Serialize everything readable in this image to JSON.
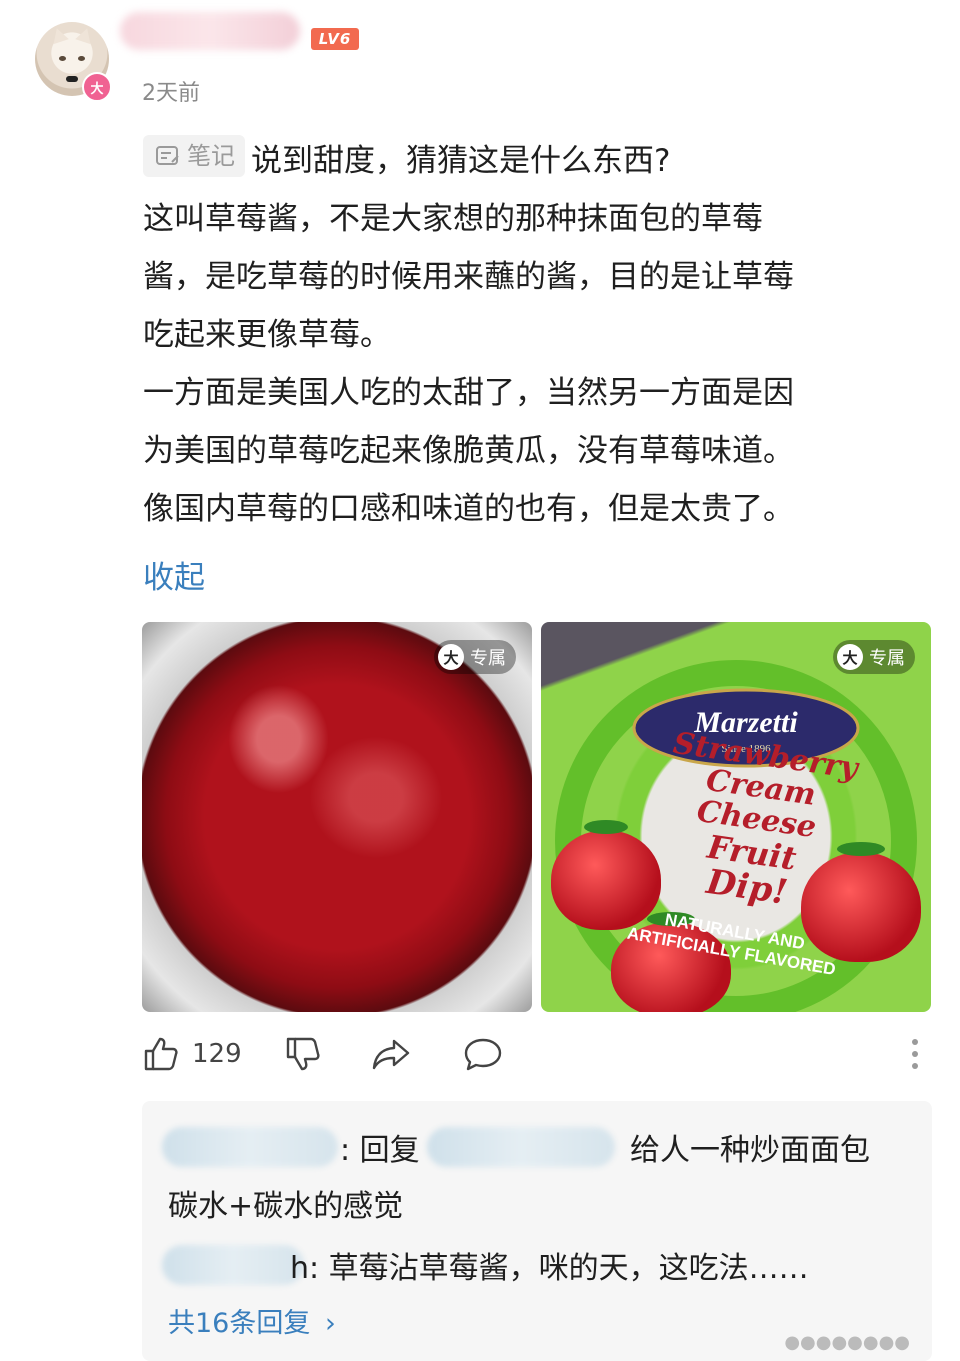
{
  "comment": {
    "level_badge": "LV6",
    "avatar_badge": "大",
    "timestamp": "2天前",
    "note_tag": "笔记",
    "lines": [
      "说到甜度，猜猜这是什么东西?",
      "这叫草莓酱，不是大家想的那种抹面包的草莓",
      "酱，是吃草莓的时候用来蘸的酱，目的是让草莓",
      "吃起来更像草莓。",
      "一方面是美国人吃的太甜了，当然另一方面是因",
      "为美国的草莓吃起来像脆黄瓜，没有草莓味道。",
      "像国内草莓的口感和味道的也有，但是太贵了。"
    ],
    "collapse_label": "收起"
  },
  "images": {
    "exclusive_icon": "大",
    "exclusive_label": "专属",
    "product": {
      "brand": "Marzetti",
      "since": "Since 1896",
      "name_lines": [
        "Strawberry",
        "Cream Cheese",
        "Fruit",
        "Dip!"
      ],
      "flavor_lines": [
        "NATURALLY AND",
        "ARTIFICIALLY FLAVORED"
      ]
    }
  },
  "actions": {
    "like_count": "129"
  },
  "replies": {
    "items": [
      {
        "text_a": ": 回复",
        "text_b": "给人一种炒面面包",
        "text_c": "碳水+碳水的感觉"
      },
      {
        "text_a": "h: 草莓沾草莓酱，咪的天，这吃法……"
      }
    ],
    "total_label": "共16条回复",
    "chevron": "›"
  },
  "watermark": "●●●●●●●●"
}
